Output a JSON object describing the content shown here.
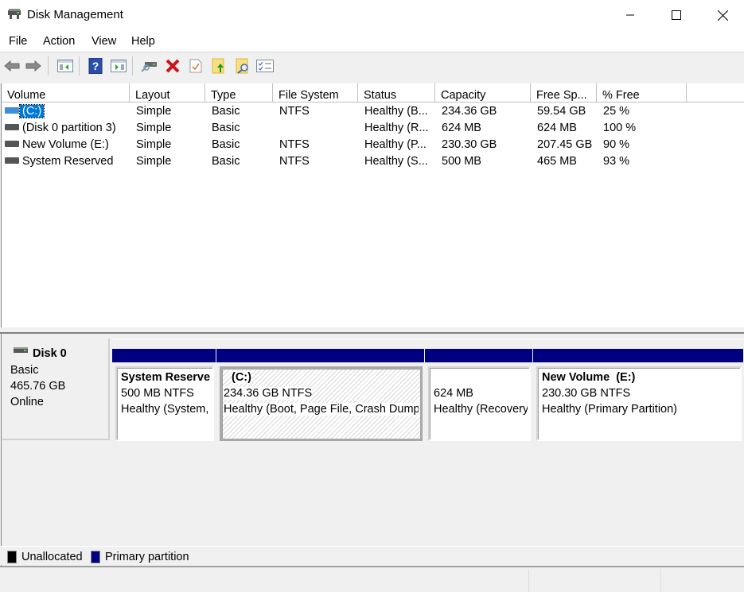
{
  "window": {
    "title": "Disk Management",
    "controls": {
      "minimize": "minimize-icon",
      "maximize": "maximize-icon",
      "close": "close-icon"
    }
  },
  "menu": [
    "File",
    "Action",
    "View",
    "Help"
  ],
  "toolbar": [
    {
      "name": "back",
      "icon": "back-arrow-icon"
    },
    {
      "name": "forward",
      "icon": "forward-arrow-icon"
    },
    {
      "name": "show-hide-console-tree",
      "icon": "console-tree-icon"
    },
    {
      "name": "help",
      "icon": "help-icon"
    },
    {
      "name": "show-hide-action-pane",
      "icon": "action-pane-icon"
    },
    {
      "name": "connect-virtual-disk",
      "icon": "disk-connect-icon"
    },
    {
      "name": "delete",
      "icon": "delete-icon"
    },
    {
      "name": "properties",
      "icon": "properties-icon"
    },
    {
      "name": "export-list",
      "icon": "folder-up-icon"
    },
    {
      "name": "explore",
      "icon": "folder-search-icon"
    },
    {
      "name": "settings",
      "icon": "checklist-icon"
    }
  ],
  "volume_list": {
    "columns": [
      "Volume",
      "Layout",
      "Type",
      "File System",
      "Status",
      "Capacity",
      "Free Sp...",
      "% Free"
    ],
    "rows": [
      {
        "volume": "(C:)",
        "layout": "Simple",
        "type": "Basic",
        "fs": "NTFS",
        "status": "Healthy (B...",
        "capacity": "234.36 GB",
        "free": "59.54 GB",
        "pct": "25 %",
        "selected": true,
        "icon_color": "#3c8fd8"
      },
      {
        "volume": "(Disk 0 partition 3)",
        "layout": "Simple",
        "type": "Basic",
        "fs": "",
        "status": "Healthy (R...",
        "capacity": "624 MB",
        "free": "624 MB",
        "pct": "100 %",
        "selected": false,
        "icon_color": "#555555"
      },
      {
        "volume": "New Volume (E:)",
        "layout": "Simple",
        "type": "Basic",
        "fs": "NTFS",
        "status": "Healthy (P...",
        "capacity": "230.30 GB",
        "free": "207.45 GB",
        "pct": "90 %",
        "selected": false,
        "icon_color": "#555555"
      },
      {
        "volume": "System Reserved",
        "layout": "Simple",
        "type": "Basic",
        "fs": "NTFS",
        "status": "Healthy (S...",
        "capacity": "500 MB",
        "free": "465 MB",
        "pct": "93 %",
        "selected": false,
        "icon_color": "#555555"
      }
    ]
  },
  "disk": {
    "name": "Disk 0",
    "type": "Basic",
    "size": "465.76 GB",
    "state": "Online",
    "partitions": [
      {
        "title": "System Reserve",
        "size": "500 MB NTFS",
        "status": "Healthy (System,",
        "selected": false
      },
      {
        "title": "(C:)",
        "size": "234.36 GB NTFS",
        "status": "Healthy (Boot, Page File, Crash Dump",
        "selected": true
      },
      {
        "title": "",
        "size": "624 MB",
        "status": "Healthy (Recovery",
        "selected": false
      },
      {
        "title": "New Volume  (E:)",
        "size": "230.30 GB NTFS",
        "status": "Healthy (Primary Partition)",
        "selected": false
      }
    ]
  },
  "legend": [
    {
      "label": "Unallocated",
      "color": "#000000"
    },
    {
      "label": "Primary partition",
      "color": "#000080"
    }
  ]
}
